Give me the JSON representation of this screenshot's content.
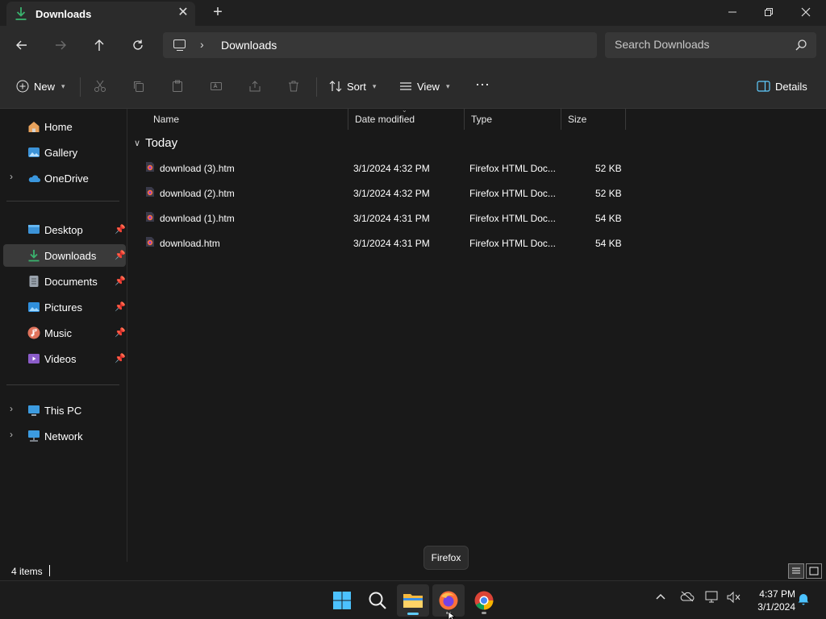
{
  "window": {
    "tab_title": "Downloads",
    "tab_close_glyph": "✕",
    "new_tab_glyph": "+",
    "minimize_glyph": "—",
    "close_glyph": "✕"
  },
  "nav": {
    "back_icon": "arrow-left-icon",
    "forward_icon": "arrow-right-icon",
    "up_icon": "arrow-up-icon",
    "refresh_icon": "refresh-icon",
    "breadcrumb_separator": "›",
    "breadcrumb": "Downloads",
    "search_placeholder": "Search Downloads"
  },
  "commands": {
    "new_label": "New",
    "sort_label": "Sort",
    "view_label": "View",
    "more_label": "···",
    "details_label": "Details"
  },
  "sidebar": {
    "pin_glyph": "📌",
    "expand_glyph": "›",
    "items": [
      {
        "label": "Home",
        "icon": "home-icon"
      },
      {
        "label": "Gallery",
        "icon": "gallery-icon"
      },
      {
        "label": "OneDrive",
        "icon": "cloud-icon"
      },
      {
        "label": "Desktop",
        "icon": "desktop-icon"
      },
      {
        "label": "Downloads",
        "icon": "download-icon"
      },
      {
        "label": "Documents",
        "icon": "documents-icon"
      },
      {
        "label": "Pictures",
        "icon": "pictures-icon"
      },
      {
        "label": "Music",
        "icon": "music-icon"
      },
      {
        "label": "Videos",
        "icon": "videos-icon"
      },
      {
        "label": "This PC",
        "icon": "pc-icon"
      },
      {
        "label": "Network",
        "icon": "network-icon"
      }
    ]
  },
  "columns": {
    "name": "Name",
    "date": "Date modified",
    "type": "Type",
    "size": "Size"
  },
  "group": {
    "label": "Today"
  },
  "files": [
    {
      "name": "download (3).htm",
      "date": "3/1/2024 4:32 PM",
      "type": "Firefox HTML Doc...",
      "size": "52 KB"
    },
    {
      "name": "download (2).htm",
      "date": "3/1/2024 4:32 PM",
      "type": "Firefox HTML Doc...",
      "size": "52 KB"
    },
    {
      "name": "download (1).htm",
      "date": "3/1/2024 4:31 PM",
      "type": "Firefox HTML Doc...",
      "size": "54 KB"
    },
    {
      "name": "download.htm",
      "date": "3/1/2024 4:31 PM",
      "type": "Firefox HTML Doc...",
      "size": "54 KB"
    }
  ],
  "status": {
    "item_count": "4 items"
  },
  "tooltip": {
    "text": "Firefox"
  },
  "taskbar": {
    "time": "4:37 PM",
    "date": "3/1/2024"
  },
  "colors": {
    "accent": "#60cdff",
    "download_green": "#3ab26e",
    "background": "#191919",
    "toolbar": "#2b2b2b"
  }
}
